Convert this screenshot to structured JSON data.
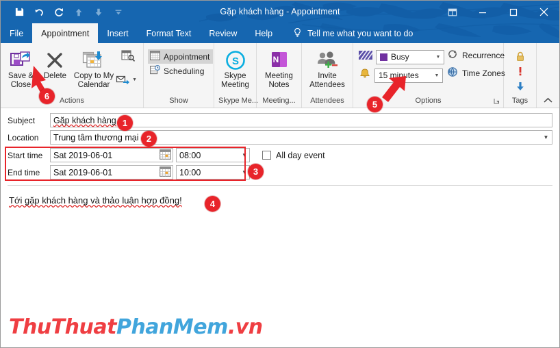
{
  "window": {
    "title": "Gặp khách hàng  -  Appointment",
    "quick_access": [
      {
        "name": "save-icon",
        "label": "Save",
        "dim": false
      },
      {
        "name": "undo-icon",
        "label": "Undo",
        "dim": false
      },
      {
        "name": "redo-icon",
        "label": "Redo",
        "dim": false
      },
      {
        "name": "previous-item-icon",
        "label": "Previous Item",
        "dim": true
      },
      {
        "name": "next-item-icon",
        "label": "Next Item",
        "dim": true
      },
      {
        "name": "customize-quick-access-icon",
        "label": "Customize Quick Access Toolbar",
        "dim": false
      }
    ],
    "controls": {
      "ribbon_display": "Ribbon Display Options",
      "minimize": "Minimize",
      "restore": "Restore Down",
      "close": "Close"
    }
  },
  "tabs": [
    {
      "label": "File",
      "active": false
    },
    {
      "label": "Appointment",
      "active": true
    },
    {
      "label": "Insert",
      "active": false
    },
    {
      "label": "Format Text",
      "active": false
    },
    {
      "label": "Review",
      "active": false
    },
    {
      "label": "Help",
      "active": false
    }
  ],
  "tell_me": "Tell me what you want to do",
  "ribbon": {
    "groups": {
      "actions": {
        "label": "Actions",
        "save_close": "Save &\nClose",
        "save_close_line1": "Save &",
        "save_close_line2": "Close",
        "delete": "Delete",
        "copy_line1": "Copy to My",
        "copy_line2": "Calendar",
        "forward_label": "Forward"
      },
      "show": {
        "label": "Show",
        "appointment": "Appointment",
        "scheduling": "Scheduling"
      },
      "skype": {
        "label": "Skype Me...",
        "btn_line1": "Skype",
        "btn_line2": "Meeting"
      },
      "meeting_notes": {
        "label": "Meeting...",
        "btn_line1": "Meeting",
        "btn_line2": "Notes"
      },
      "attendees": {
        "label": "Attendees",
        "btn_line1": "Invite",
        "btn_line2": "Attendees"
      },
      "options": {
        "label": "Options",
        "show_as_value": "Busy",
        "show_as_color": "#7030a0",
        "reminder_value": "15 minutes",
        "recurrence": "Recurrence",
        "time_zones": "Time Zones"
      },
      "tags": {
        "label": "Tags",
        "private": "Private",
        "high_importance": "High Importance",
        "low_importance": "Low Importance"
      }
    }
  },
  "form": {
    "subject_label": "Subject",
    "subject_value": "Gặp khách hàng",
    "location_label": "Location",
    "location_value": "Trung tâm thương mại",
    "start_label": "Start time",
    "start_date": "Sat 2019-06-01",
    "start_time": "08:00",
    "end_label": "End time",
    "end_date": "Sat 2019-06-01",
    "end_time": "10:00",
    "all_day_label": "All day event",
    "all_day_checked": false,
    "body_text": "Tới gặp khách hàng và thảo luận hợp đồng!"
  },
  "annotations": {
    "badges": [
      {
        "id": "1",
        "target": "subject-input"
      },
      {
        "id": "2",
        "target": "location-input"
      },
      {
        "id": "3",
        "target": "time-fields"
      },
      {
        "id": "4",
        "target": "body-text"
      },
      {
        "id": "5",
        "target": "reminder-combo"
      },
      {
        "id": "6",
        "target": "save-close-button"
      }
    ],
    "highlight_color": "#e8242a"
  },
  "watermark": {
    "part1": "ThuThuat",
    "part2": "PhanMem",
    "part3": ".vn",
    "color1": "#ef3e42",
    "color2": "#41a5dc"
  }
}
